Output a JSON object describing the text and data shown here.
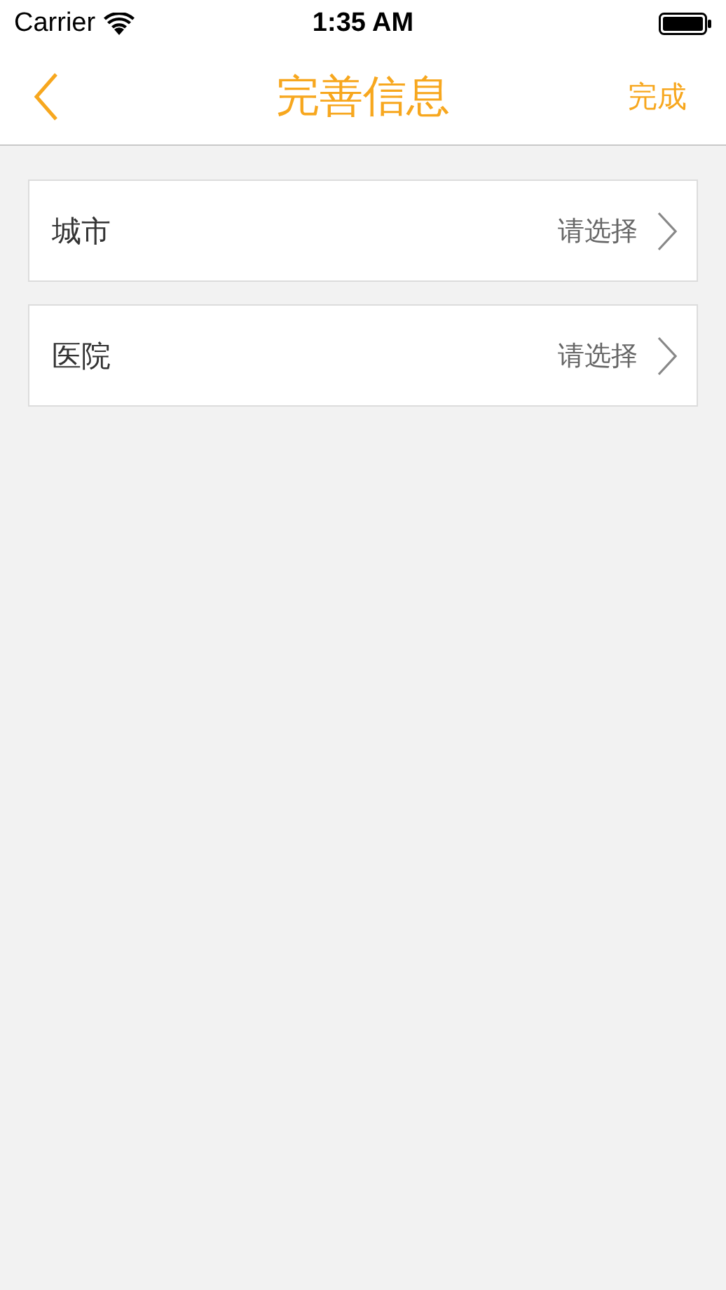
{
  "status_bar": {
    "carrier": "Carrier",
    "time": "1:35 AM"
  },
  "nav": {
    "title": "完善信息",
    "action": "完成"
  },
  "rows": [
    {
      "label": "城市",
      "value": "请选择"
    },
    {
      "label": "医院",
      "value": "请选择"
    }
  ]
}
